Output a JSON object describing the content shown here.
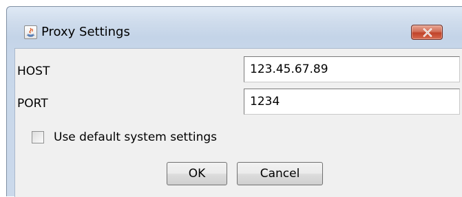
{
  "window": {
    "title": "Proxy Settings",
    "icon": "java-cup-icon",
    "close_icon": "close-icon"
  },
  "form": {
    "host_label": "HOST",
    "host_value": "123.45.67.89",
    "port_label": "PORT",
    "port_value": "1234",
    "default_settings_label": "Use default system settings",
    "default_settings_checked": false
  },
  "buttons": {
    "ok_label": "OK",
    "cancel_label": "Cancel"
  },
  "colors": {
    "close_button": "#c0432a",
    "dialog_background": "#f0f0f0",
    "title_bar": "#cfdcec"
  }
}
